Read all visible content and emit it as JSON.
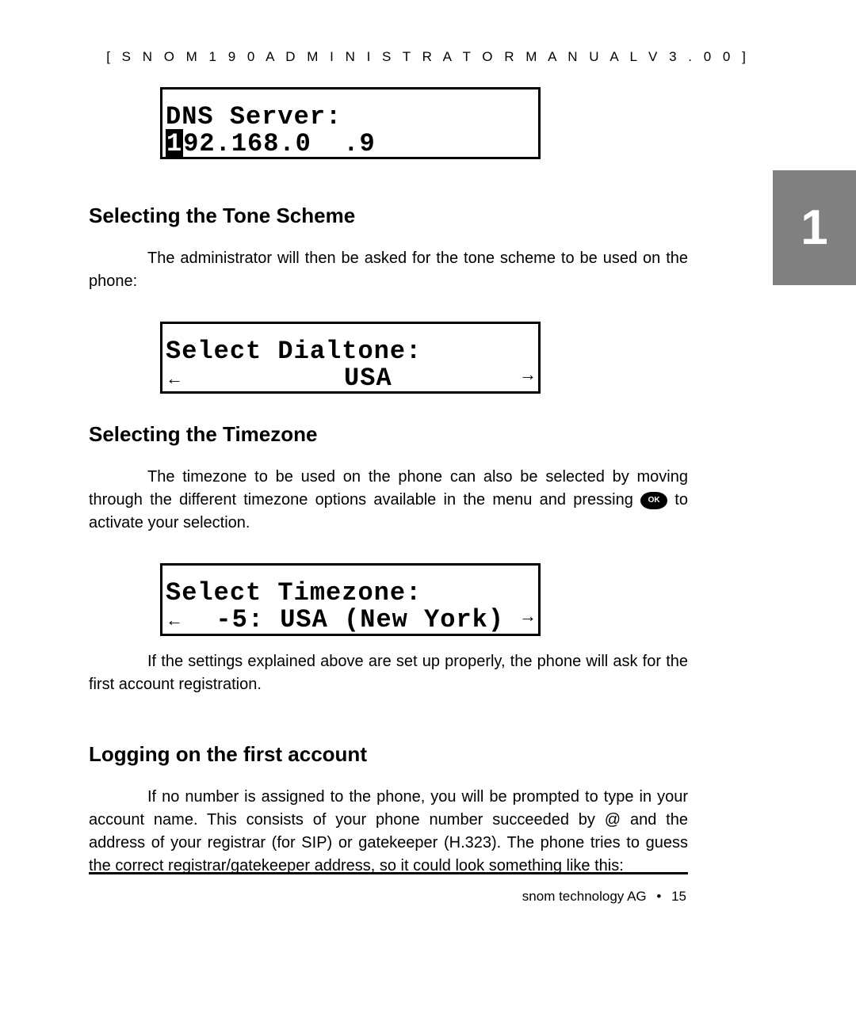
{
  "header": {
    "text": "[  S N O M   1 9 0   A D M I N I S T R A T O R   M A N U A L   V 3 . 0 0   ]"
  },
  "chapter": {
    "number": "1"
  },
  "lcd1": {
    "line1": "DNS Server:",
    "cursor_char": "1",
    "line2_rest": "92.168.0  .9"
  },
  "section1": {
    "heading": "Selecting the Tone Scheme",
    "para": "The administrator will then be asked for the tone scheme to be used on the phone:"
  },
  "lcd2": {
    "line1": "Select Dialtone:",
    "left_arrow": "←",
    "value": "          USA",
    "right_arrow": "→"
  },
  "section2": {
    "heading": "Selecting the Timezone",
    "para_before": "The timezone to be used on the phone can also be selected by moving through the different timezone options available in the menu and pressing ",
    "ok_label": "OK",
    "para_after": " to activate your selection."
  },
  "lcd3": {
    "line1": "Select Timezone:",
    "left_arrow": "←",
    "value": "  -5: USA (New York)",
    "right_arrow": "→"
  },
  "para_after_lcd3": "If the settings explained above are set up properly, the phone will ask for the first account registration.",
  "section3": {
    "heading": "Logging on the first account",
    "para": "If no number is assigned to the phone, you will be prompted to type in your account name. This consists of your phone number succeeded by @ and the address of your registrar (for SIP) or gatekeeper (H.323). The phone tries to guess the correct registrar/gatekeeper address, so it could look something like this:"
  },
  "footer": {
    "company": "snom technology AG",
    "dot": "•",
    "page": "15"
  }
}
